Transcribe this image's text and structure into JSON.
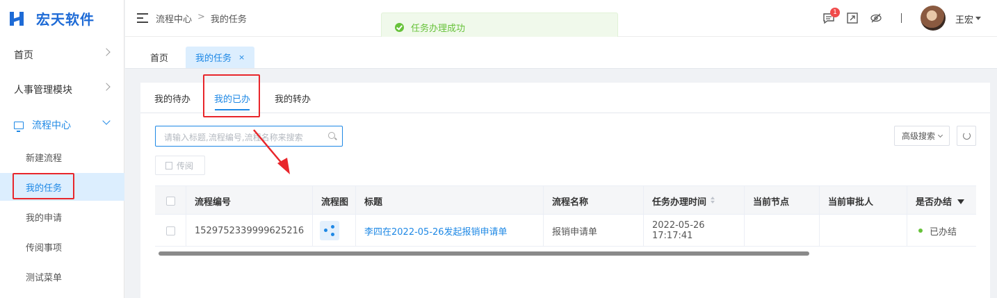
{
  "brand": {
    "name": "宏天软件",
    "accent": "#1e88e5",
    "logo_color": "#1e6bd6"
  },
  "sidebar": {
    "items": [
      {
        "label": "首页"
      },
      {
        "label": "人事管理模块"
      },
      {
        "label": "流程中心"
      }
    ],
    "sub_items": [
      {
        "label": "新建流程"
      },
      {
        "label": "我的任务"
      },
      {
        "label": "我的申请"
      },
      {
        "label": "传阅事项"
      },
      {
        "label": "测试菜单"
      }
    ]
  },
  "header": {
    "breadcrumb": [
      "流程中心",
      ">",
      "我的任务"
    ],
    "message_badge": "1",
    "user_name": "王宏"
  },
  "toast": {
    "text": "任务办理成功",
    "color": "#67c23a"
  },
  "page_tabs": [
    {
      "label": "首页"
    },
    {
      "label": "我的任务",
      "close": "×"
    }
  ],
  "inner_tabs": [
    {
      "label": "我的待办"
    },
    {
      "label": "我的已办"
    },
    {
      "label": "我的转办"
    }
  ],
  "search": {
    "placeholder": "请输入标题,流程编号,流程名称来搜索"
  },
  "buttons": {
    "advanced_search": "高级搜索",
    "circulate": "传阅"
  },
  "table": {
    "headers": [
      "流程编号",
      "流程图",
      "标题",
      "流程名称",
      "任务办理时间",
      "当前节点",
      "当前审批人",
      "是否办结"
    ],
    "rows": [
      {
        "id": "1529752339999625216",
        "title": "李四在2022-05-26发起报销申请单",
        "flow_name": "报销申请单",
        "time": "2022-05-26 17:17:41",
        "node": "",
        "approver": "",
        "status": "已办结"
      }
    ]
  },
  "annotation_color": "#e8262b"
}
